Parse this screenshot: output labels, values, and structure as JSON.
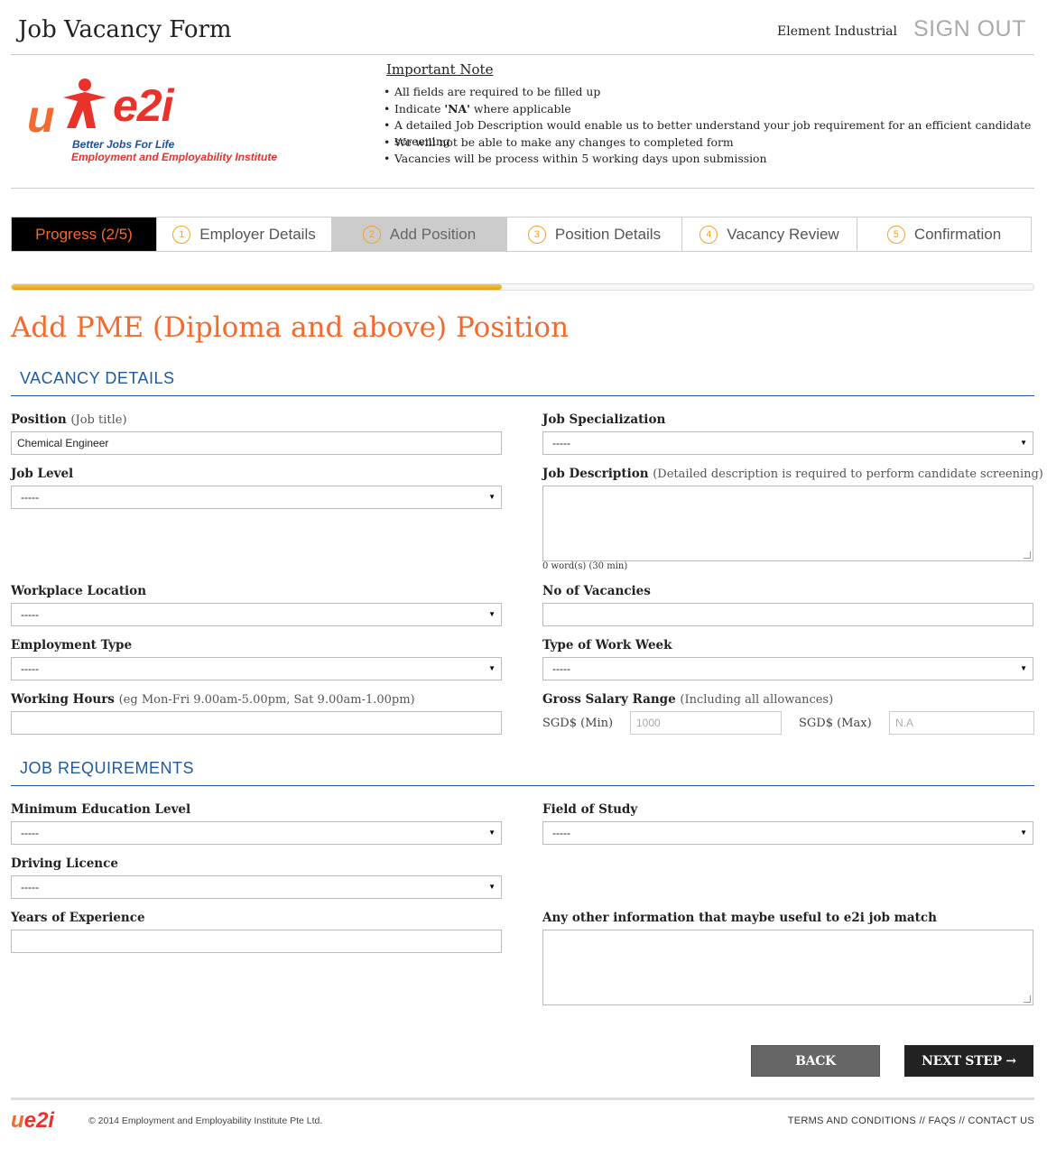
{
  "header": {
    "title": "Job Vacancy Form",
    "company": "Element Industrial",
    "sign_out": "SIGN OUT"
  },
  "logo": {
    "mark": "e2i",
    "tagline": "Better Jobs For Life",
    "institute": "Employment and Employability Institute"
  },
  "note": {
    "title": "Important Note",
    "items": [
      "All fields are required to be filled up",
      "where applicable",
      "A detailed Job Description would enable us to better understand your job requirement for an efficient candidate screening",
      "We will not be able to make any changes to completed form",
      "Vacancies will be process within 5 working days upon submission"
    ],
    "item2_prefix": "Indicate ",
    "item2_bold": "'NA'"
  },
  "tabs": {
    "progress": "Progress (2/5)",
    "steps": [
      {
        "num": "1",
        "label": "Employer Details"
      },
      {
        "num": "2",
        "label": "Add Position"
      },
      {
        "num": "3",
        "label": "Position Details"
      },
      {
        "num": "4",
        "label": "Vacancy Review"
      },
      {
        "num": "5",
        "label": "Confirmation"
      }
    ]
  },
  "progress": {
    "fraction": 0.48
  },
  "colors": {
    "accent": "#f26a2e",
    "section_blue": "#1f5aa0",
    "progress_gold": "#f0a42a"
  },
  "page_title": "Add PME (Diploma and above) Position",
  "vacancy": {
    "section": "VACANCY DETAILS",
    "position_label": "Position",
    "position_hint": "(Job title)",
    "position_value": "Chemical Engineer",
    "specialization_label": "Job Specialization",
    "specialization_value": "-----",
    "level_label": "Job Level",
    "level_value": "-----",
    "description_label": "Job Description",
    "description_hint": "(Detailed description is required to perform candidate screening)",
    "word_count": "0 word(s) (30 min)",
    "location_label": "Workplace Location",
    "location_value": "-----",
    "vacancies_label": "No of Vacancies",
    "employment_label": "Employment Type",
    "employment_value": "-----",
    "workweek_label": "Type of Work Week",
    "workweek_value": "-----",
    "hours_label": "Working Hours",
    "hours_hint": "(eg Mon-Fri 9.00am-5.00pm, Sat 9.00am-1.00pm)",
    "salary_label": "Gross Salary Range",
    "salary_hint": "(Including all allowances)",
    "salary_min_label": "SGD$ (Min)",
    "salary_min_placeholder": "1000",
    "salary_max_label": "SGD$ (Max)",
    "salary_max_placeholder": "N.A"
  },
  "requirements": {
    "section": "JOB REQUIREMENTS",
    "education_label": "Minimum Education Level",
    "education_value": "-----",
    "field_label": "Field of Study",
    "field_value": "-----",
    "licence_label": "Driving Licence",
    "licence_value": "-----",
    "experience_label": "Years of Experience",
    "other_label": "Any other information that maybe useful to e2i job match"
  },
  "buttons": {
    "back": "BACK",
    "next": "NEXT STEP →"
  },
  "footer": {
    "logo_u": "u",
    "logo_e2i": "e2i",
    "copyright": "© 2014 Employment and Employability Institute Pte Ltd.",
    "terms": "TERMS AND CONDITIONS",
    "faqs": "FAQS",
    "contact": "CONTACT US",
    "sep": "//"
  }
}
